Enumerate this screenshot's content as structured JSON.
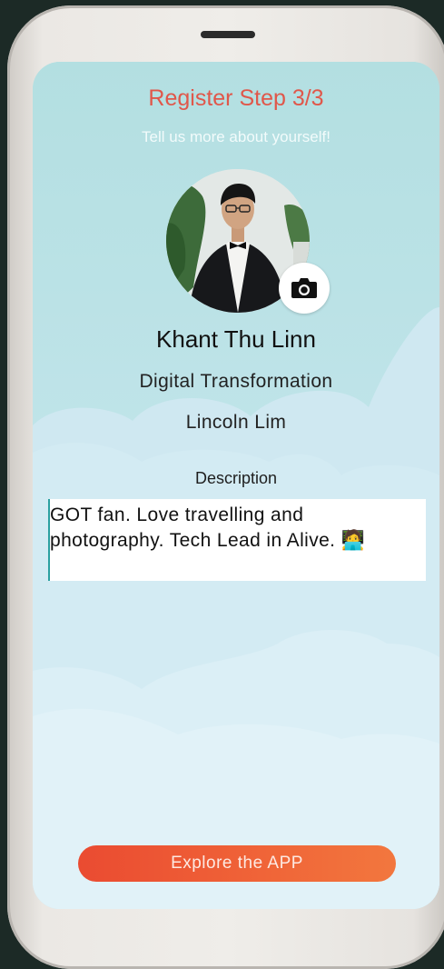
{
  "header": {
    "title": "Register Step 3/3",
    "subtitle": "Tell us more about yourself!"
  },
  "profile": {
    "photo_icon": "camera-icon",
    "name": "Khant Thu Linn",
    "department": "Digital Transformation",
    "manager": "Lincoln Lim"
  },
  "description": {
    "label": "Description",
    "value": "GOT fan. Love travelling and photography. Tech Lead in Alive. 🧑‍💻"
  },
  "actions": {
    "explore_label": "Explore the APP"
  },
  "colors": {
    "title": "#e0574a",
    "screen_bg": "#b5e0e2",
    "button_start": "#ea4b31",
    "button_end": "#f2773e"
  }
}
